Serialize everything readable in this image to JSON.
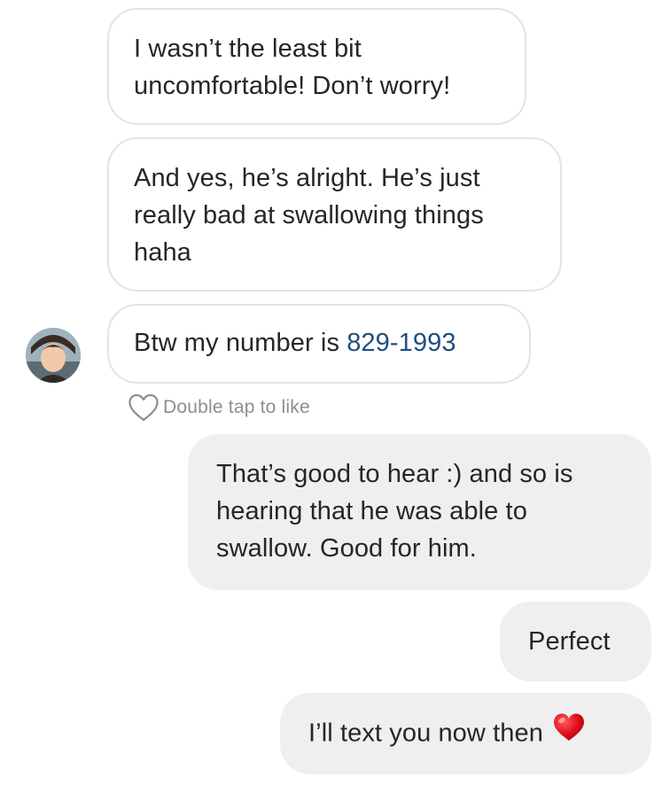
{
  "messages": {
    "m1_line1": "I wasn’t the least bit",
    "m1_line2": "uncomfortable! Don’t worry!",
    "m2_line1": "And yes, he’s alright. He’s just",
    "m2_line2": "really bad at swallowing things",
    "m2_line3": "haha",
    "m3_prefix": "Btw my number is ",
    "m3_number": "829-1993",
    "like_hint": "Double tap to like",
    "m4_line1": "That’s good to hear :) and so is",
    "m4_line2": "hearing that he was able to",
    "m4_line3": "swallow. Good for him.",
    "m5": "Perfect",
    "m6": "I’ll text you now then"
  },
  "icons": {
    "like": "heart-outline-icon",
    "emoji": "red-heart-emoji-icon"
  },
  "colors": {
    "incoming_border": "#e3e3e3",
    "outgoing_bg": "#efefef",
    "link": "#1f4f7f",
    "secondary_text": "#8e8e8e",
    "heart_red": "#e0101e"
  }
}
